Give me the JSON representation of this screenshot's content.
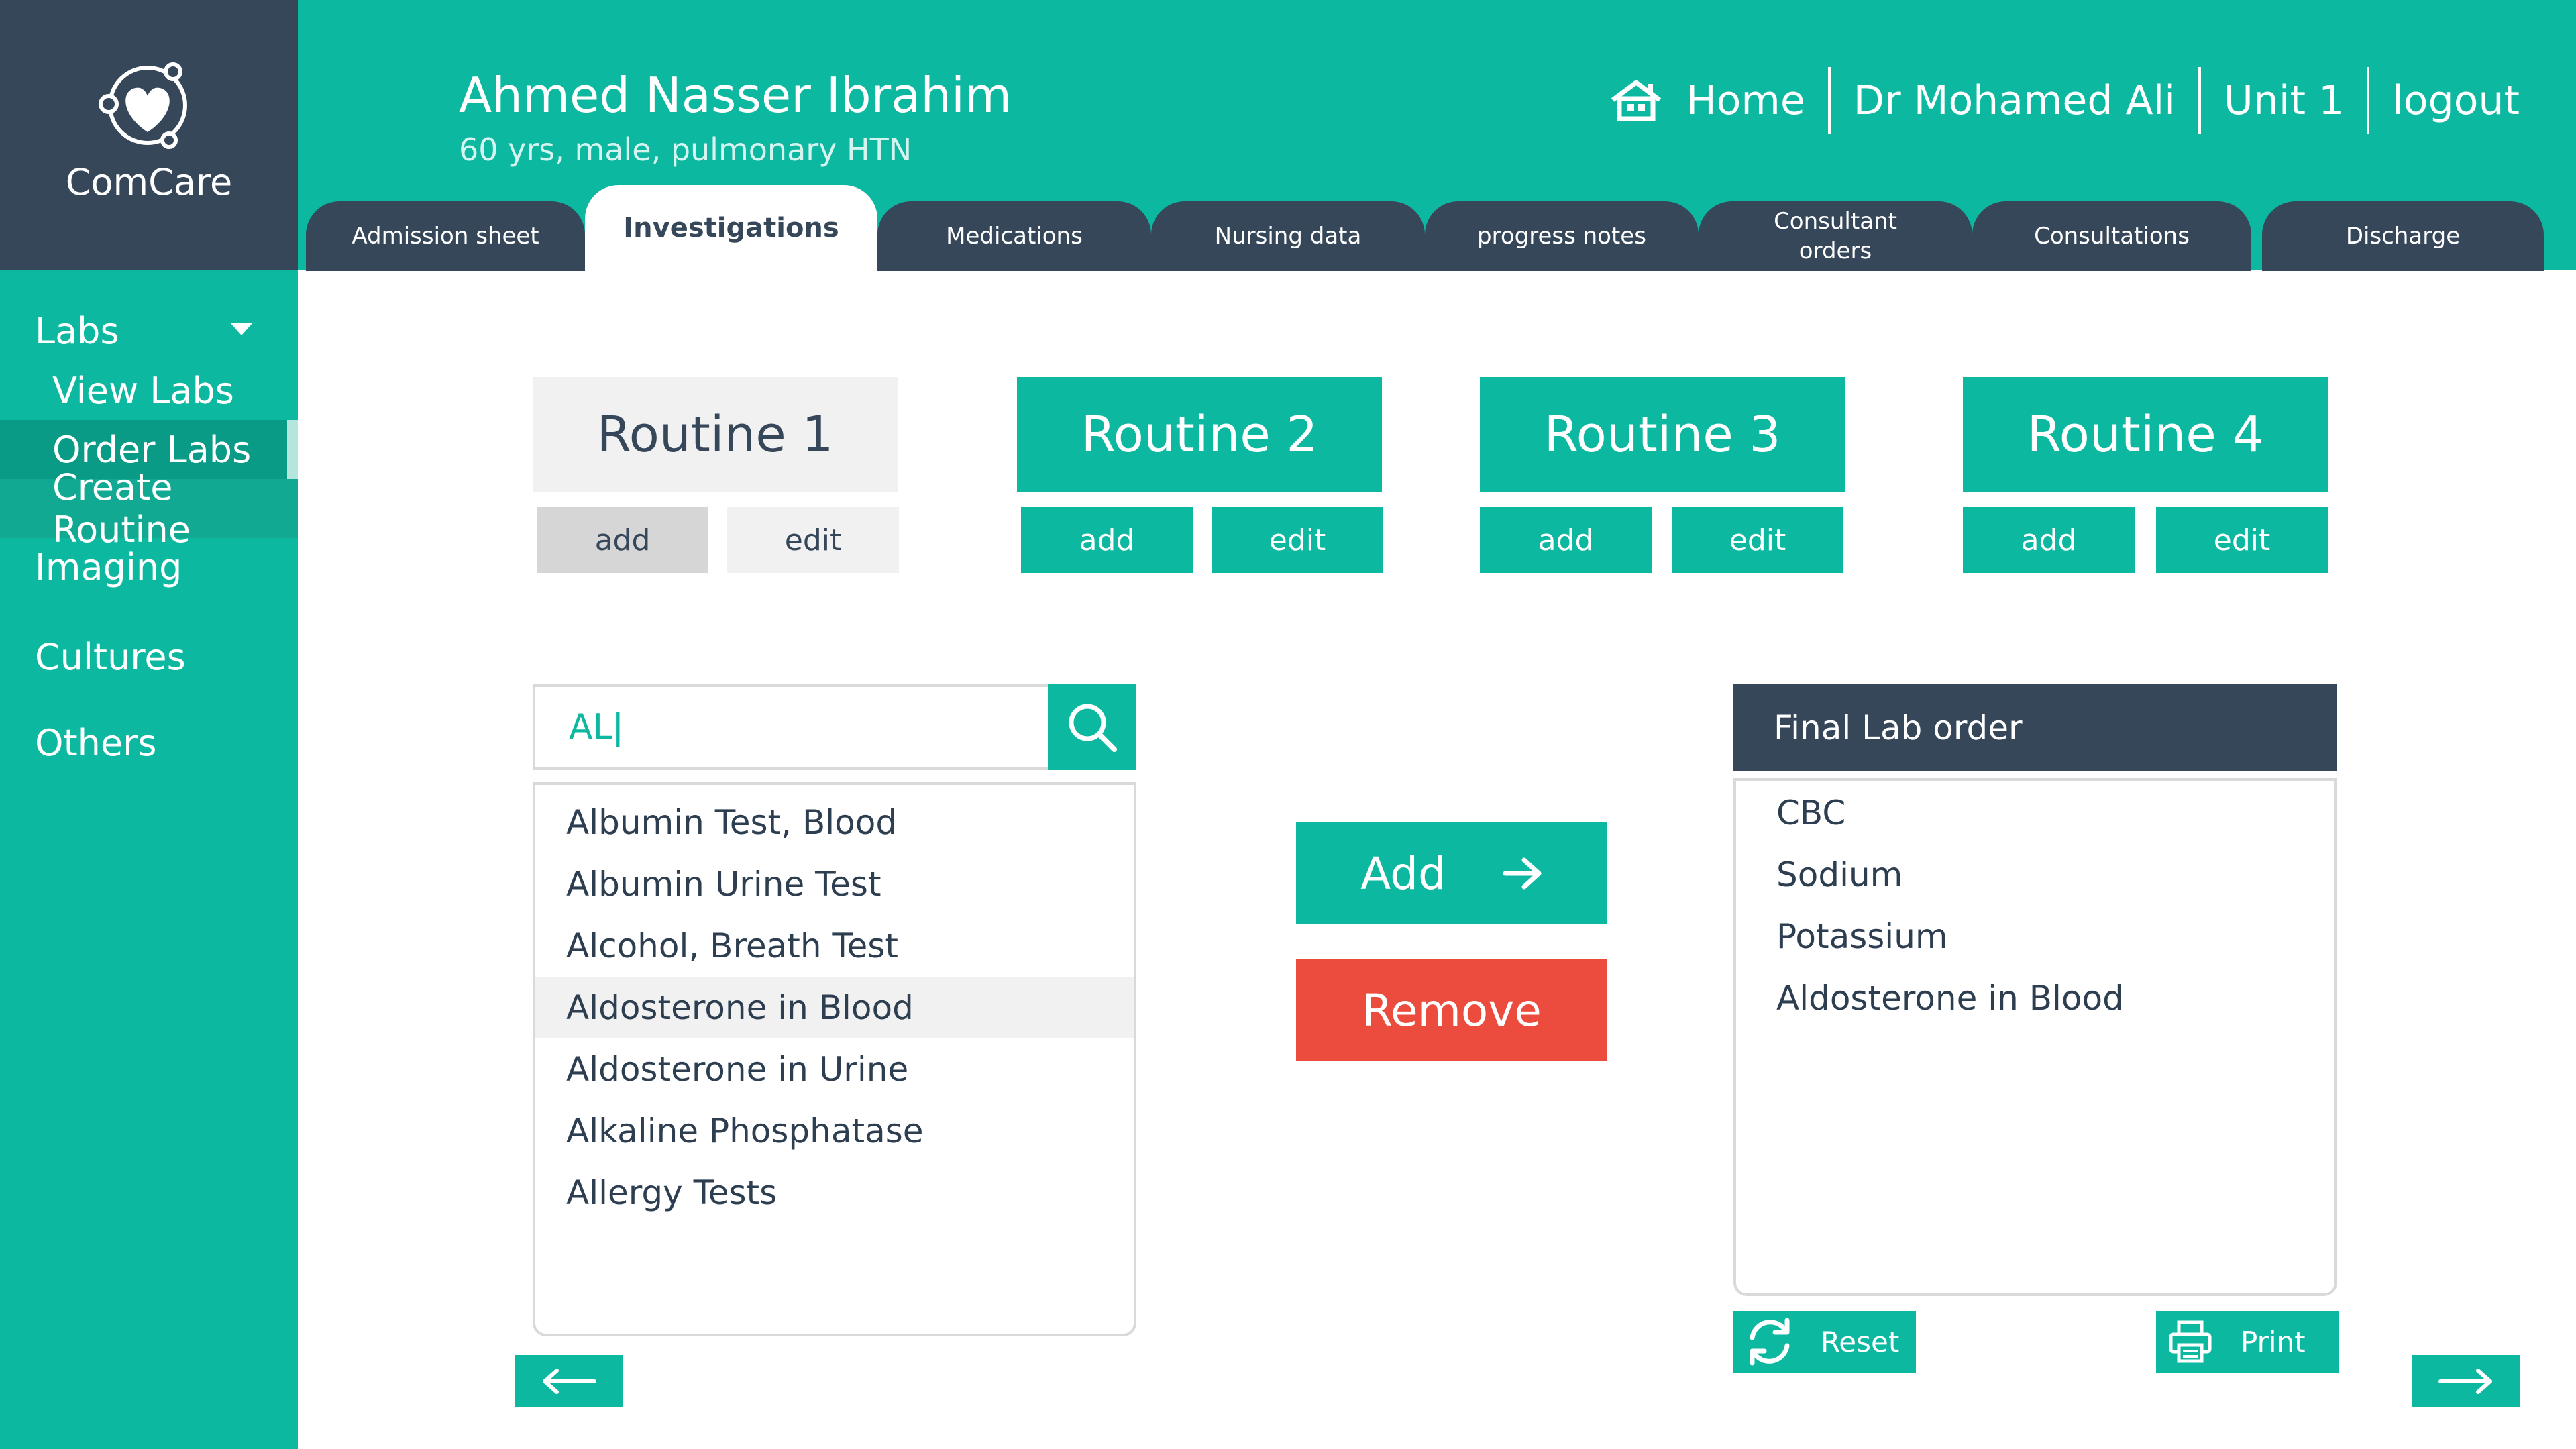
{
  "app": {
    "name": "ComCare"
  },
  "patient": {
    "name": "Ahmed Nasser Ibrahim",
    "info": "60 yrs, male, pulmonary HTN"
  },
  "top_nav": {
    "home": "Home",
    "doctor": "Dr Mohamed Ali",
    "unit": "Unit 1",
    "logout": "logout"
  },
  "tabs": [
    {
      "label": "Admission sheet"
    },
    {
      "label": "Investigations"
    },
    {
      "label": "Medications"
    },
    {
      "label": "Nursing data"
    },
    {
      "label": "progress notes"
    },
    {
      "label": "Consultant\norders"
    },
    {
      "label": "Consultations"
    },
    {
      "label": "Discharge"
    }
  ],
  "sidebar": {
    "labs": "Labs",
    "view_labs": "View Labs",
    "order_labs": "Order Labs",
    "create_routine": "Create Routine",
    "imaging": "Imaging",
    "cultures": "Cultures",
    "others": "Others"
  },
  "routines": [
    {
      "label": "Routine 1",
      "add": "add",
      "edit": "edit"
    },
    {
      "label": "Routine 2",
      "add": "add",
      "edit": "edit"
    },
    {
      "label": "Routine 3",
      "add": "add",
      "edit": "edit"
    },
    {
      "label": "Routine 4",
      "add": "add",
      "edit": "edit"
    }
  ],
  "search": {
    "value": "AL|"
  },
  "results": [
    "Albumin Test, Blood",
    "Albumin Urine Test",
    "Alcohol, Breath Test",
    "Aldosterone in Blood",
    "Aldosterone in Urine",
    "Alkaline Phosphatase",
    "Allergy Tests"
  ],
  "actions": {
    "add": "Add",
    "remove": "Remove"
  },
  "final_order": {
    "title": "Final Lab order",
    "items": [
      "CBC",
      "Sodium",
      "Potassium",
      "Aldosterone in Blood"
    ],
    "reset": "Reset",
    "print": "Print"
  },
  "colors": {
    "teal": "#0db8a1",
    "navy": "#36475a",
    "red": "#eb4c3e"
  },
  "icons": {
    "logo": "heart-logo-icon",
    "home": "home-icon",
    "search": "search-icon",
    "reset": "refresh-icon",
    "print": "printer-icon"
  }
}
